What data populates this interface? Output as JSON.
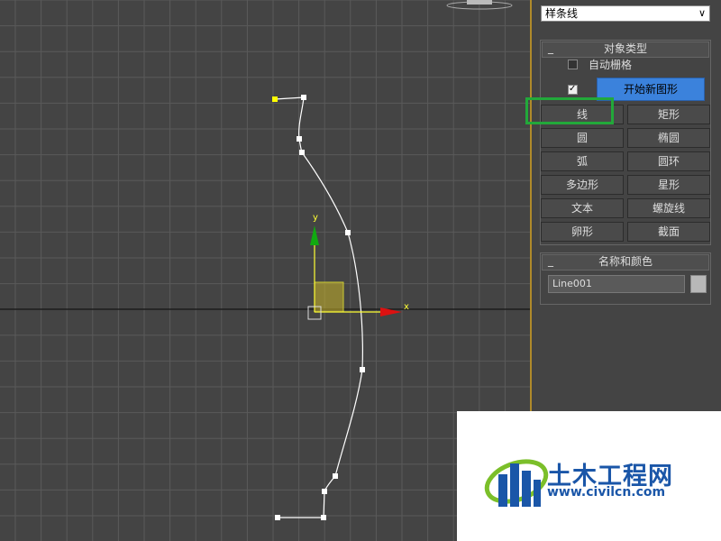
{
  "viewport": {
    "axis_x_label": "x",
    "axis_y_label": "y",
    "colors": {
      "background": "#444444",
      "grid": "#595959",
      "spline": "#ffffff",
      "x_axis": "#dd1111",
      "y_axis": "#11aa11",
      "gizmo": "#ffff33"
    }
  },
  "panel": {
    "dropdown_value": "样条线",
    "object_type": {
      "header": "对象类型",
      "auto_grid_label": "自动栅格",
      "auto_grid_checked": false,
      "start_new_shape_checked": true,
      "start_new_shape_label": "开始新图形",
      "buttons": [
        "线",
        "矩形",
        "圆",
        "椭圆",
        "弧",
        "圆环",
        "多边形",
        "星形",
        "文本",
        "螺旋线",
        "卵形",
        "截面"
      ]
    },
    "name_color": {
      "header": "名称和颜色",
      "name_value": "Line001",
      "swatch_color": "#b8b8b8"
    }
  },
  "watermark": {
    "text": "土木工程网",
    "url": "www.civilcn.com"
  }
}
